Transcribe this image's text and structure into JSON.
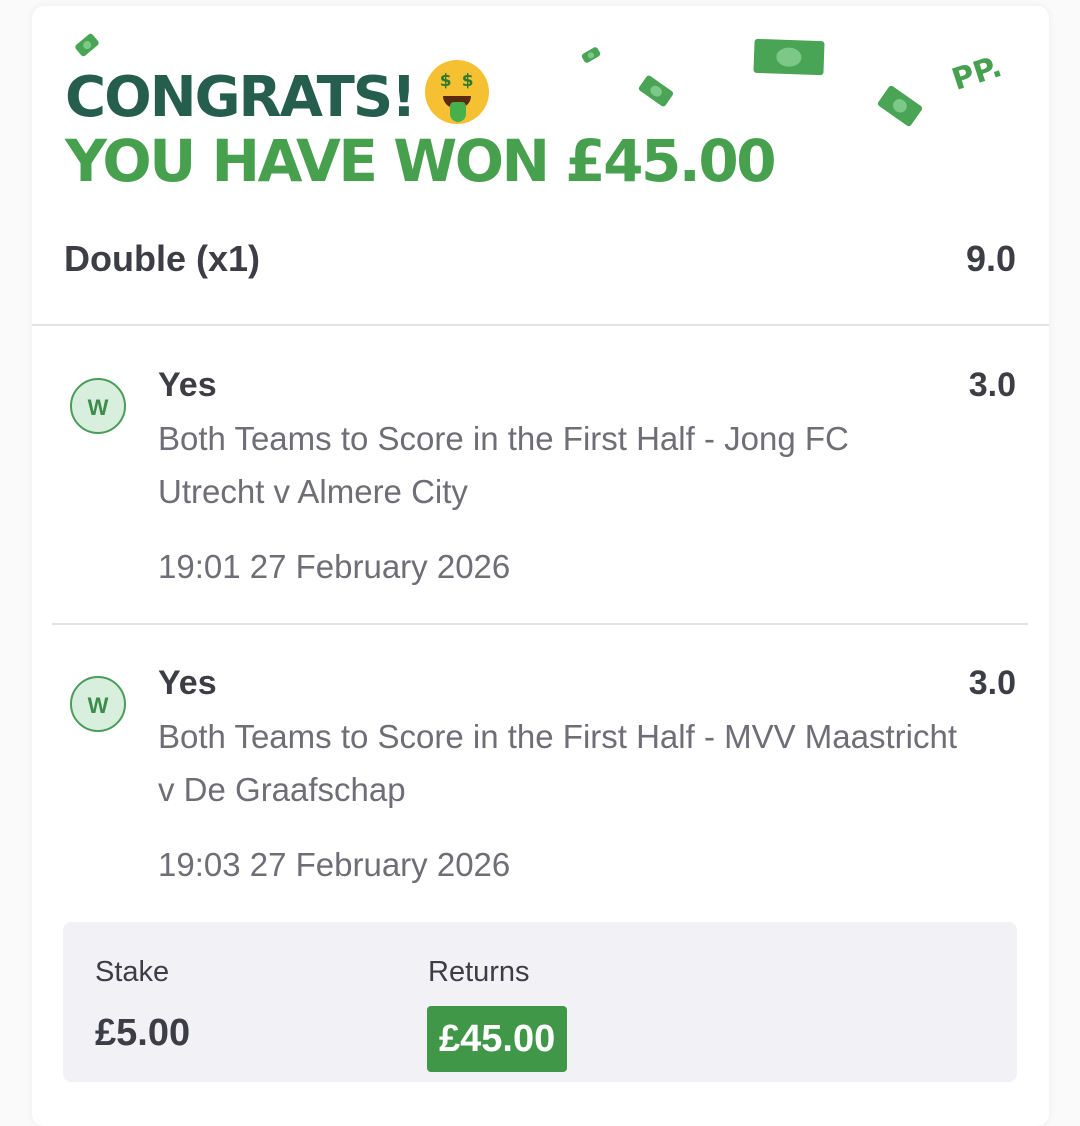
{
  "header": {
    "congrats": "CONGRATS!",
    "won_text": "YOU HAVE WON £45.00",
    "emoji_icon": "money-mouth-face",
    "confetti_text": "PP."
  },
  "bet": {
    "type": "Double (x1)",
    "total_odds": "9.0"
  },
  "selections": [
    {
      "status": "W",
      "name": "Yes",
      "odds": "3.0",
      "market": "Both Teams to Score in the First Half - Jong FC Utrecht v Almere City",
      "time": "19:01 27 February 2026"
    },
    {
      "status": "W",
      "name": "Yes",
      "odds": "3.0",
      "market": "Both Teams to Score in the First Half - MVV Maastricht v De Graafschap",
      "time": "19:03 27 February 2026"
    }
  ],
  "summary": {
    "stake_label": "Stake",
    "stake_value": "£5.00",
    "returns_label": "Returns",
    "returns_value": "£45.00"
  },
  "colors": {
    "brand_dark_green": "#265e4e",
    "brand_green": "#47a04e",
    "win_badge_bg": "#d7efdc",
    "returns_bg": "#3f9747"
  }
}
